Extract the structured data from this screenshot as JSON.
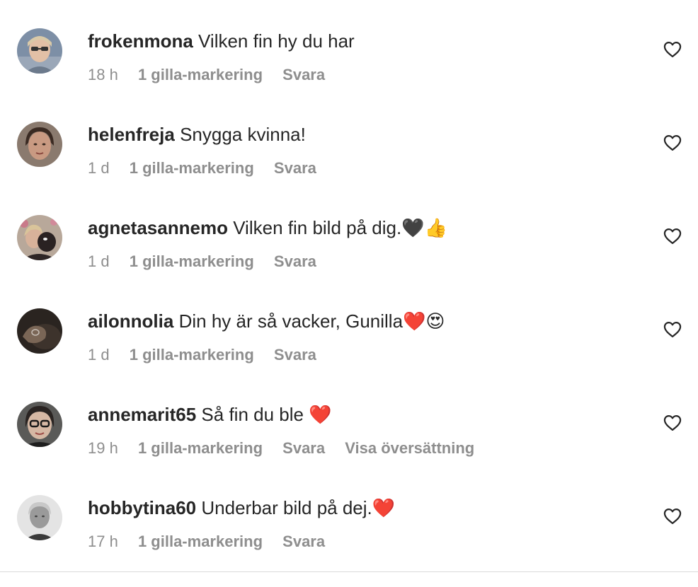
{
  "like_icon": "heart-outline-icon",
  "comments": [
    {
      "username": "frokenmona",
      "text": "Vilken fin hy du har",
      "time": "18 h",
      "likes": "1 gilla-markering",
      "reply": "Svara",
      "translate": ""
    },
    {
      "username": "helenfreja",
      "text": "Snygga kvinna!",
      "time": "1 d",
      "likes": "1 gilla-markering",
      "reply": "Svara",
      "translate": ""
    },
    {
      "username": "agnetasannemo",
      "text": "Vilken fin bild på dig.🖤👍",
      "time": "1 d",
      "likes": "1 gilla-markering",
      "reply": "Svara",
      "translate": ""
    },
    {
      "username": "ailonnolia",
      "text": "Din hy är så vacker, Gunilla❤️😍",
      "time": "1 d",
      "likes": "1 gilla-markering",
      "reply": "Svara",
      "translate": ""
    },
    {
      "username": "annemarit65",
      "text": "Så fin du ble ❤️",
      "time": "19 h",
      "likes": "1 gilla-markering",
      "reply": "Svara",
      "translate": "Visa översättning"
    },
    {
      "username": "hobbytina60",
      "text": "Underbar bild på dej.❤️",
      "time": "17 h",
      "likes": "1 gilla-markering",
      "reply": "Svara",
      "translate": ""
    }
  ]
}
